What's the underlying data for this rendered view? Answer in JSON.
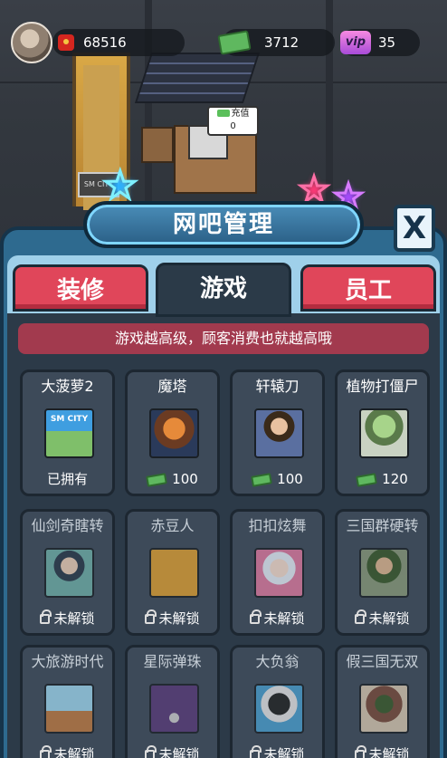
{
  "hud": {
    "coins": "68516",
    "cash": "3712",
    "vip_label": "vip",
    "vip_value": "35"
  },
  "scene": {
    "bubble_title": "充值",
    "bubble_value": "0",
    "sign_text": "SM CITY"
  },
  "panel": {
    "title": "网吧管理",
    "close_label": "X",
    "tabs": [
      {
        "label": "装修",
        "active": false
      },
      {
        "label": "游戏",
        "active": true
      },
      {
        "label": "员工",
        "active": false
      }
    ],
    "notice": "游戏越高级，顾客消费也就越高哦"
  },
  "games": [
    {
      "name": "大菠萝2",
      "status": "已拥有",
      "icon": "sm-city-icon",
      "art_text": "SM CITY"
    },
    {
      "name": "魔塔",
      "price": "100",
      "icon": "tower-icon"
    },
    {
      "name": "轩辕刀",
      "price": "100",
      "icon": "swordsman-icon"
    },
    {
      "name": "植物打僵尸",
      "price": "120",
      "icon": "zombie-icon"
    },
    {
      "name": "仙剑奇瞎转",
      "status": "未解锁",
      "icon": "heroine-icon"
    },
    {
      "name": "赤豆人",
      "status": "未解锁",
      "icon": "pacman-icon"
    },
    {
      "name": "扣扣炫舞",
      "status": "未解锁",
      "icon": "dancer-icon"
    },
    {
      "name": "三国群硬转",
      "status": "未解锁",
      "icon": "general-icon"
    },
    {
      "name": "大旅游时代",
      "status": "未解锁",
      "icon": "ship-icon"
    },
    {
      "name": "星际弹珠",
      "status": "未解锁",
      "icon": "pinball-icon"
    },
    {
      "name": "大负翁",
      "status": "未解锁",
      "icon": "monopoly-icon"
    },
    {
      "name": "假三国无双",
      "status": "未解锁",
      "icon": "warrior-icon"
    }
  ],
  "colors": {
    "panel_border": "#2e6a8f",
    "tab_red": "#e0465a",
    "notice_bg": "#a23a4e",
    "content_bg": "#2c3a48"
  }
}
